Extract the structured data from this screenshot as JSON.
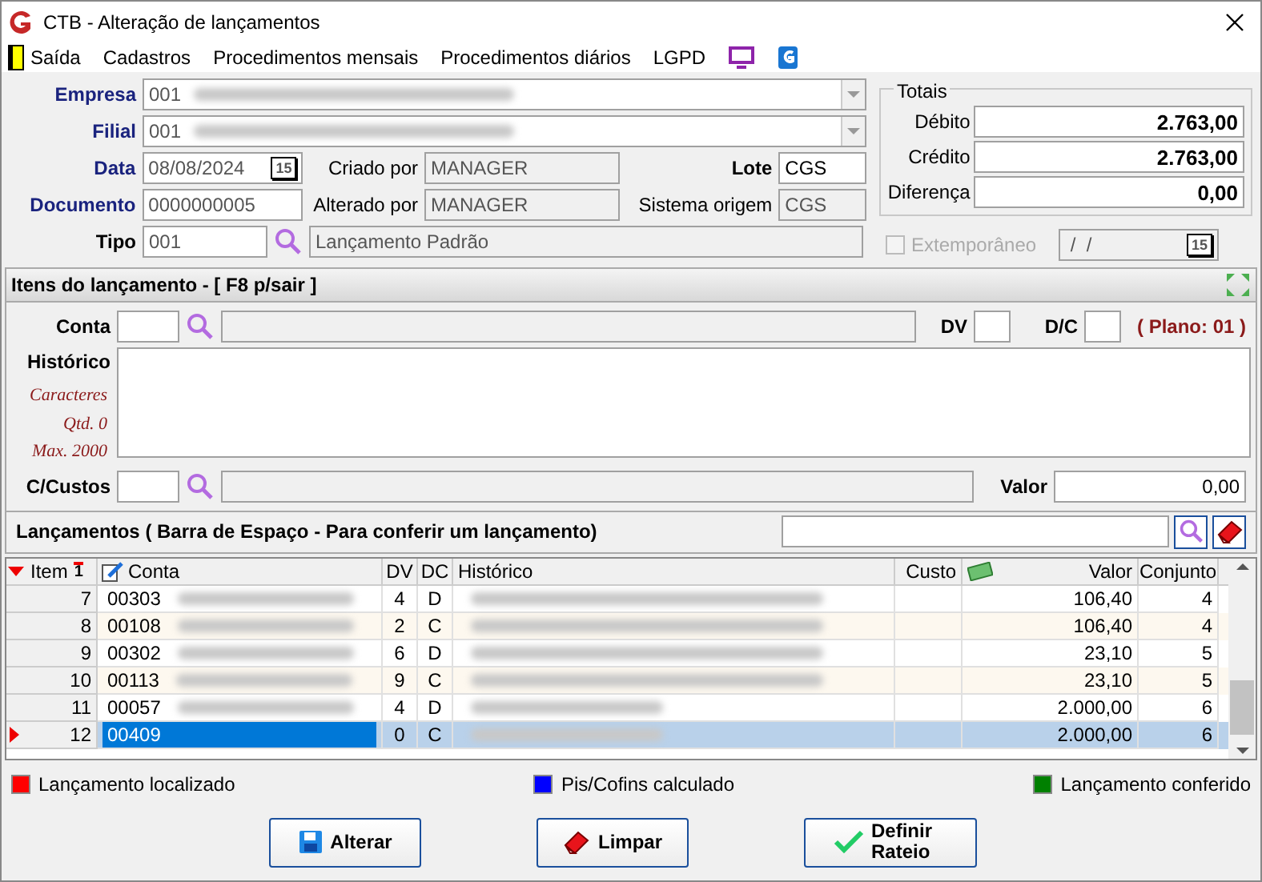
{
  "window": {
    "title": "CTB - Alteração de lançamentos"
  },
  "menu": [
    {
      "label": "Saída",
      "kind": "exit"
    },
    {
      "label": "Cadastros",
      "kind": "text"
    },
    {
      "label": "Procedimentos mensais",
      "kind": "text"
    },
    {
      "label": "Procedimentos diários",
      "kind": "text"
    },
    {
      "label": "LGPD",
      "kind": "text"
    }
  ],
  "form": {
    "empresa": {
      "label": "Empresa",
      "value": "001"
    },
    "filial": {
      "label": "Filial",
      "value": "001"
    },
    "data": {
      "label": "Data",
      "value": "08/08/2024",
      "calendar_day": "15"
    },
    "documento": {
      "label": "Documento",
      "value": "0000000005"
    },
    "tipo": {
      "label": "Tipo",
      "code": "001",
      "description": "Lançamento Padrão"
    },
    "criado_por": {
      "label": "Criado por",
      "value": "MANAGER"
    },
    "alterado_por": {
      "label": "Alterado por",
      "value": "MANAGER"
    },
    "lote": {
      "label": "Lote",
      "value": "CGS"
    },
    "sistema_origem": {
      "label": "Sistema origem",
      "value": "CGS"
    },
    "totals": {
      "title": "Totais",
      "rows": [
        {
          "label": "Débito",
          "value": "2.763,00"
        },
        {
          "label": "Crédito",
          "value": "2.763,00"
        },
        {
          "label": "Diferença",
          "value": "0,00"
        }
      ]
    },
    "extemporaneo": {
      "label": "Extemporâneo",
      "checked": false,
      "disabled": true,
      "value": " /  /",
      "calendar_day": "15"
    }
  },
  "items": {
    "title": "Itens do lançamento - [ F8 p/sair ]",
    "conta": "Conta",
    "dv": "DV",
    "dc": "D/C",
    "plano": "( Plano: 01 )",
    "historico": "Histórico",
    "notes": [
      "Caracteres",
      "Qtd. 0",
      "Max. 2000"
    ],
    "ccustos": "C/Custos",
    "valor": "Valor",
    "valor_value": "0,00"
  },
  "launches": {
    "title": "Lançamentos ( Barra de Espaço - Para conferir um lançamento)",
    "columns": [
      "Item",
      "1",
      "Conta",
      "DV",
      "DC",
      "Histórico",
      "Custo",
      "Valor",
      "Conjunto"
    ],
    "rows": [
      {
        "item": "7",
        "conta": "00303",
        "dv": "4",
        "dc": "D",
        "valor": "106,40",
        "conjunto": "4",
        "selected": false
      },
      {
        "item": "8",
        "conta": "00108",
        "dv": "2",
        "dc": "C",
        "valor": "106,40",
        "conjunto": "4",
        "selected": false
      },
      {
        "item": "9",
        "conta": "00302",
        "dv": "6",
        "dc": "D",
        "valor": "23,10",
        "conjunto": "5",
        "selected": false
      },
      {
        "item": "10",
        "conta": "00113",
        "dv": "9",
        "dc": "C",
        "valor": "23,10",
        "conjunto": "5",
        "selected": false
      },
      {
        "item": "11",
        "conta": "00057",
        "dv": "4",
        "dc": "D",
        "valor": "2.000,00",
        "conjunto": "6",
        "selected": false
      },
      {
        "item": "12",
        "conta": "00409",
        "dv": "0",
        "dc": "C",
        "valor": "2.000,00",
        "conjunto": "6",
        "selected": true
      }
    ]
  },
  "legend": [
    {
      "label": "Lançamento localizado",
      "color": "#ff0000"
    },
    {
      "label": "Pis/Cofins calculado",
      "color": "#0000ff"
    },
    {
      "label": "Lançamento conferido",
      "color": "#008000"
    }
  ],
  "buttons": [
    {
      "label": "Alterar",
      "kind": "save"
    },
    {
      "label": "Limpar",
      "kind": "clear"
    },
    {
      "label": "Definir Rateio",
      "kind": "confirm"
    }
  ]
}
